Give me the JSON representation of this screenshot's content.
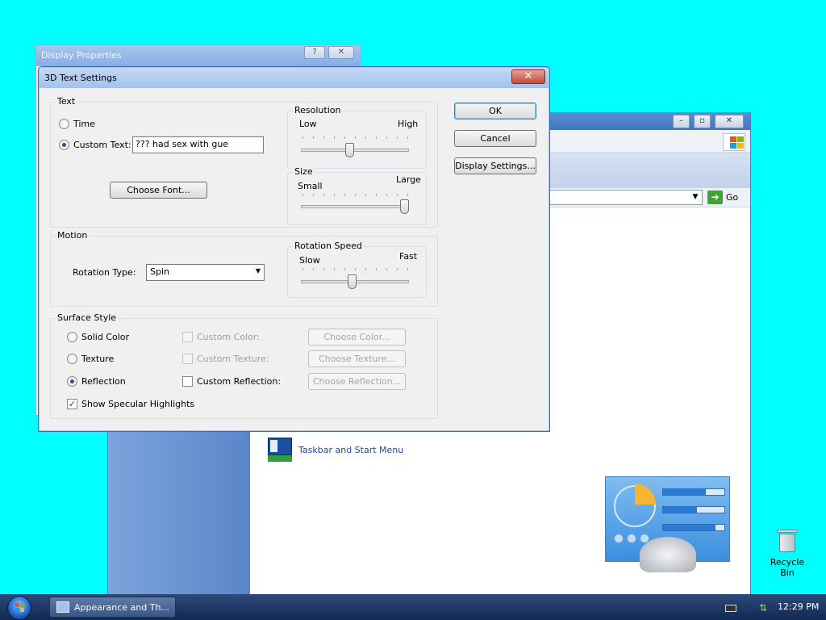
{
  "control_panel": {
    "go_label": "Go",
    "task_link": "Taskbar and Start Menu"
  },
  "display_properties": {
    "title": "Display Properties",
    "help_button": "?",
    "close_button": "✕"
  },
  "dialog": {
    "title": "3D Text Settings",
    "close_button": "✕",
    "text_group": {
      "label": "Text",
      "time_label": "Time",
      "time_selected": false,
      "custom_text_label": "Custom Text:",
      "custom_text_selected": true,
      "custom_text_value": "??? had sex with gue",
      "choose_font_button": "Choose Font..."
    },
    "resolution": {
      "label": "Resolution",
      "low_label": "Low",
      "high_label": "High",
      "value_fraction": 0.45
    },
    "size": {
      "label": "Size",
      "small_label": "Small",
      "large_label": "Large",
      "value_fraction": 1.0
    },
    "motion_group": {
      "label": "Motion",
      "rotation_type_label": "Rotation Type:",
      "rotation_type_value": "Spin"
    },
    "rotation_speed": {
      "label": "Rotation Speed",
      "slow_label": "Slow",
      "fast_label": "Fast",
      "value_fraction": 0.47
    },
    "surface_group": {
      "label": "Surface Style",
      "solid_color_label": "Solid Color",
      "texture_label": "Texture",
      "reflection_label": "Reflection",
      "selected": "Reflection",
      "custom_color_label": "Custom Color:",
      "custom_texture_label": "Custom Texture:",
      "custom_reflection_label": "Custom Reflection:",
      "choose_color_button": "Choose Color...",
      "choose_texture_button": "Choose Texture...",
      "choose_reflection_button": "Choose Reflection...",
      "show_specular_label": "Show Specular Highlights",
      "show_specular_checked": true
    },
    "ok_button": "OK",
    "cancel_button": "Cancel",
    "display_settings_button": "Display Settings..."
  },
  "desktop": {
    "recycle_bin_label": "Recycle Bin"
  },
  "taskbar": {
    "task_button_label": "Appearance and Th...",
    "clock": "12:29 PM"
  }
}
